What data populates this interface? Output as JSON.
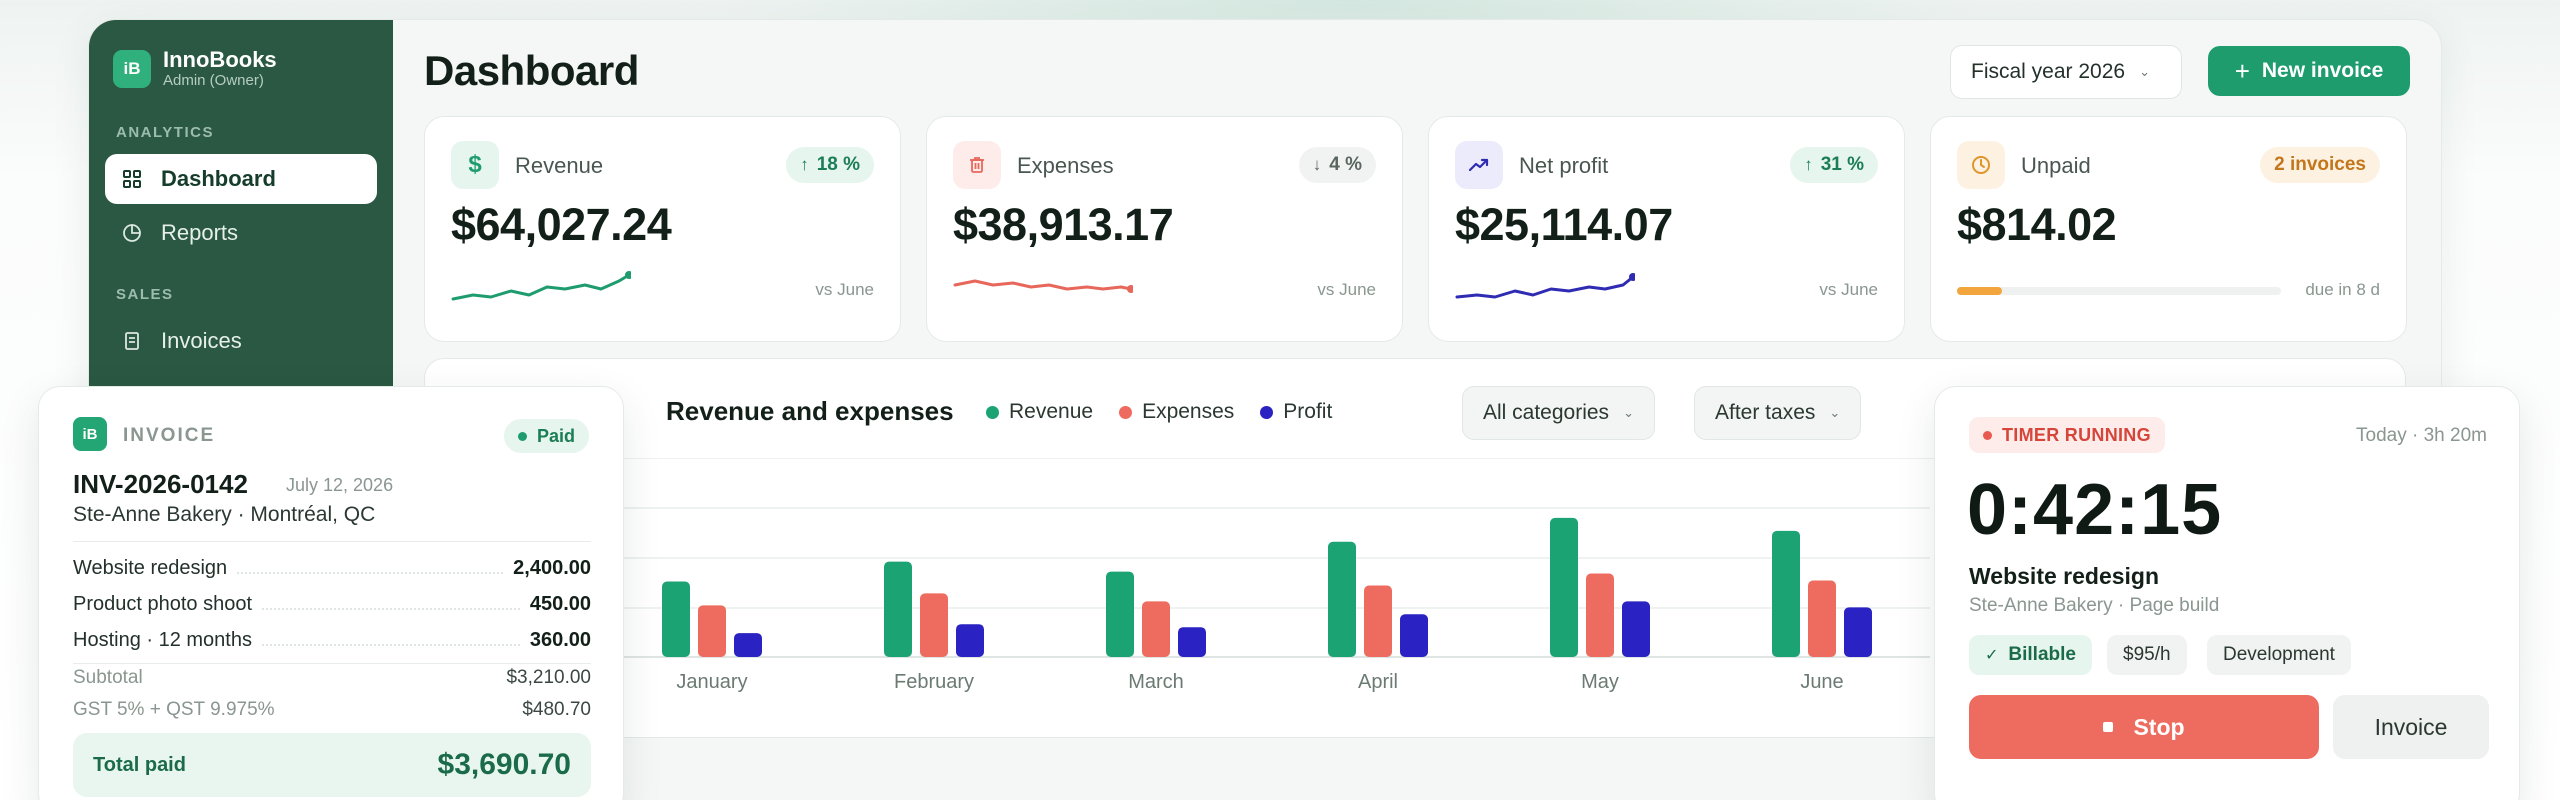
{
  "brand": {
    "logo": "iB",
    "name": "InnoBooks",
    "role": "Admin (Owner)"
  },
  "sidebar": {
    "sections": [
      {
        "label": "ANALYTICS"
      },
      {
        "label": "SALES"
      }
    ],
    "items": [
      {
        "label": "Dashboard",
        "icon": "grid-icon",
        "active": true
      },
      {
        "label": "Reports",
        "icon": "pie-chart-icon",
        "active": false
      },
      {
        "label": "Invoices",
        "icon": "document-icon",
        "active": false
      }
    ]
  },
  "header": {
    "title": "Dashboard",
    "fiscal_year": "Fiscal year 2026",
    "new_invoice": "New invoice"
  },
  "kpis": [
    {
      "label": "Revenue",
      "icon": "dollar-icon",
      "badge": "18 %",
      "trend": "up",
      "value": "$64,027.24",
      "foot": "vs June",
      "color": "#1e9c6e"
    },
    {
      "label": "Expenses",
      "icon": "trash-icon",
      "badge": "4 %",
      "trend": "down",
      "value": "$38,913.17",
      "foot": "vs June",
      "color": "#e8675b"
    },
    {
      "label": "Net profit",
      "icon": "trend-up-icon",
      "badge": "31 %",
      "trend": "up",
      "value": "$25,114.07",
      "foot": "vs June",
      "color": "#2f2bb3"
    },
    {
      "label": "Unpaid",
      "icon": "clock-icon",
      "badge": "2 invoices",
      "value": "$814.02",
      "foot": "due in 8 d",
      "progress": 0.14,
      "color": "#f1a53c"
    }
  ],
  "chart": {
    "filter_categories": "All categories",
    "filter_taxes": "After taxes"
  },
  "chart_data": {
    "type": "bar",
    "title": "Revenue and expenses",
    "categories": [
      "January",
      "February",
      "March",
      "April",
      "May",
      "June"
    ],
    "series": [
      {
        "name": "Revenue",
        "color": "#1ba374",
        "values": [
          7.6,
          9.6,
          8.6,
          11.6,
          14.0,
          12.7
        ]
      },
      {
        "name": "Expenses",
        "color": "#ee6b5f",
        "values": [
          5.2,
          6.4,
          5.6,
          7.2,
          8.4,
          7.7
        ]
      },
      {
        "name": "Profit",
        "color": "#2a22c2",
        "values": [
          2.4,
          3.3,
          3.0,
          4.3,
          5.6,
          5.0
        ]
      }
    ],
    "ylim": [
      0,
      15
    ],
    "grid": true,
    "legend": "top"
  },
  "invoice": {
    "kicker": "INVOICE",
    "status": "Paid",
    "number": "INV-2026-0142",
    "date": "July 12, 2026",
    "client": "Ste-Anne Bakery · Montréal, QC",
    "lines": [
      {
        "label": "Website redesign",
        "amount": "2,400.00"
      },
      {
        "label": "Product photo shoot",
        "amount": "450.00"
      },
      {
        "label": "Hosting · 12 months",
        "amount": "360.00"
      }
    ],
    "subtotal_label": "Subtotal",
    "subtotal": "$3,210.00",
    "tax_label": "GST 5% + QST 9.975%",
    "tax": "$480.70",
    "total_label": "Total paid",
    "total": "$3,690.70"
  },
  "timer": {
    "badge": "TIMER RUNNING",
    "meta": "Today · 3h 20m",
    "clock": "0:42:15",
    "task": "Website redesign",
    "sub": "Ste-Anne Bakery · Page build",
    "chips": [
      "Billable",
      "$95/h",
      "Development"
    ],
    "stop": "Stop",
    "invoice": "Invoice"
  }
}
